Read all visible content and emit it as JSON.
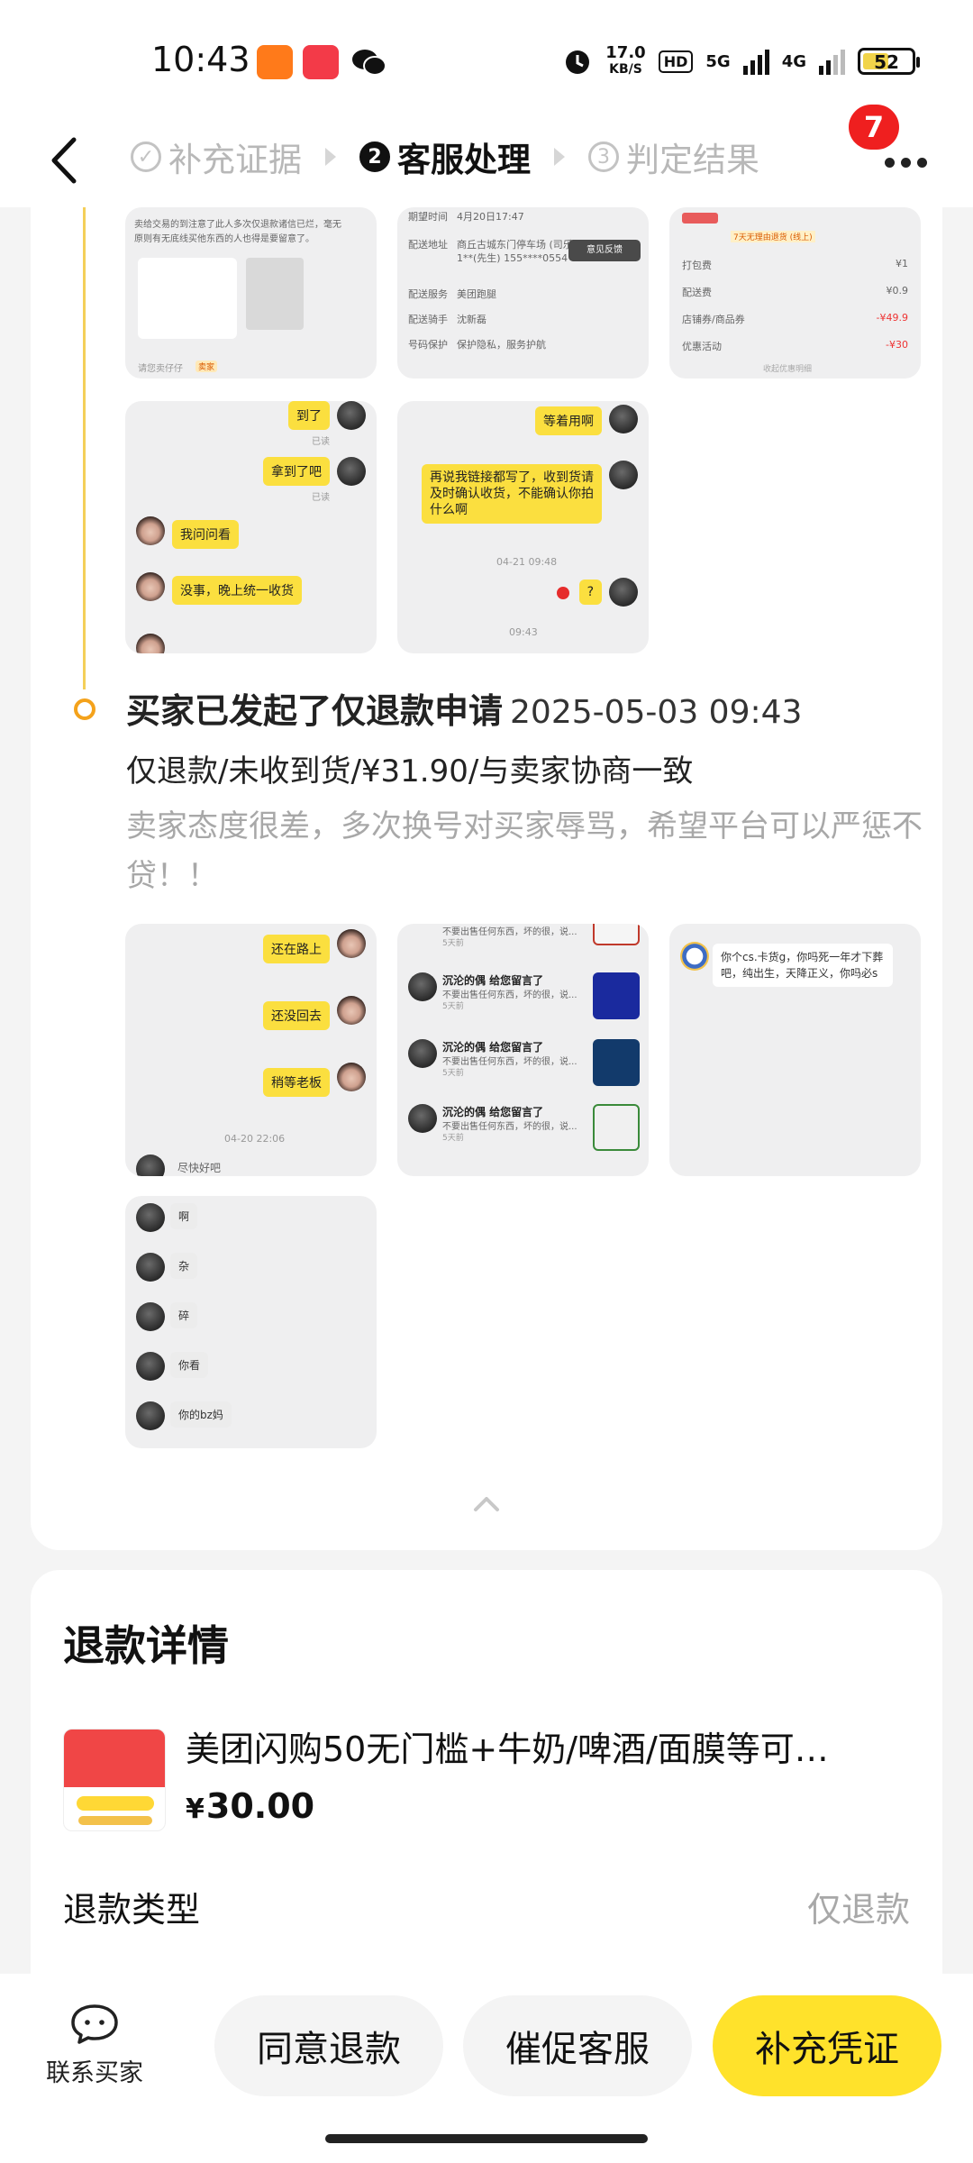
{
  "status_bar": {
    "time": "10:43",
    "net_speed_value": "17.0",
    "net_speed_unit": "KB/S",
    "hd_badge": "HD",
    "net_5g": "5G",
    "net_4g": "4G",
    "battery": "52"
  },
  "header": {
    "steps": [
      {
        "num": "✓",
        "label": "补充证据"
      },
      {
        "num": "2",
        "label": "客服处理"
      },
      {
        "num": "3",
        "label": "判定结果"
      }
    ],
    "notification_count": "7"
  },
  "evidence_top": {
    "thumb1_lines": [
      "卖给交易的到注意了此人多次仅退款诸信已烂，毫无",
      "原则有无底线买他东西的人也得是要留意了。"
    ],
    "thumb1_footer": "请您卖仔仔",
    "thumb1_footer_tag": "卖家",
    "thumb2_rows": [
      {
        "k": "期望时间",
        "v": "4月20日17:47"
      },
      {
        "k": "配送地址",
        "v": "商丘古城东门停车场 (司乐"
      },
      {
        "k": "",
        "v": "1**(先生) 155****0554"
      },
      {
        "k": "配送服务",
        "v": "美团跑腿"
      },
      {
        "k": "配送骑手",
        "v": "沈新磊"
      },
      {
        "k": "号码保护",
        "v": "保护隐私，服务护航"
      }
    ],
    "thumb2_feedback": "意见反馈",
    "thumb3_rows": [
      {
        "k": "打包费",
        "v": "¥1"
      },
      {
        "k": "配送费",
        "v": "¥0.9"
      },
      {
        "k": "店铺券/商品券",
        "v": "-¥49.9"
      },
      {
        "k": "优惠活动",
        "v": "-¥30"
      }
    ],
    "thumb3_tag": "7天无理由退货 (线上)",
    "thumb3_footer": "收起优惠明细"
  },
  "chat_a": {
    "messages": [
      "到了",
      "拿到了吧",
      "我问问看",
      "没事，晚上统一收货"
    ],
    "read": "已读"
  },
  "chat_b": {
    "messages": [
      "等着用啊",
      "再说我链接都写了，收到货请及时确认收货，不能确认你拍什么啊",
      "?"
    ],
    "times": [
      "04-21 09:48",
      "09:43"
    ]
  },
  "event": {
    "title": "买家已发起了仅退款申请",
    "time": "2025-05-03 09:43",
    "subtitle": "仅退款/未收到货/¥31.90/与卖家协商一致",
    "description": "卖家态度很差，多次换号对买家辱骂，希望平台可以严惩不贷！！"
  },
  "evidence_bottom": {
    "chat_c": {
      "messages": [
        "还在路上",
        "还没回去",
        "稍等老板",
        "尽快好吧"
      ],
      "time": "04-20 22:06"
    },
    "chat_d": {
      "sender": "沉沦的偶 给您留言了",
      "preview": "不要出售任何东西，坏的很，说...",
      "items": [
        "5天前",
        "5天前",
        "5天前",
        "5天前"
      ]
    },
    "chat_e": {
      "message": "你个cs.卡货g，你吗死一年才下葬吧，纯出生，天降正义，你吗必s"
    },
    "chat_f": {
      "messages": [
        "啊",
        "杂",
        "碎",
        "你看",
        "你的bz妈"
      ]
    }
  },
  "refund": {
    "title": "退款详情",
    "product_name": "美团闪购50无门槛+牛奶/啤酒/面膜等可…",
    "price_currency": "¥",
    "price": "30.00",
    "type_label": "退款类型",
    "type_value": "仅退款"
  },
  "bottom_bar": {
    "contact_label": "联系买家",
    "btn_agree": "同意退款",
    "btn_urge": "催促客服",
    "btn_supplement": "补充凭证"
  },
  "colors": {
    "accent_yellow": "#ffe22b",
    "timeline_line": "#f4cf59",
    "timeline_dot": "#f4a21b",
    "badge_red": "#ef1f1f"
  }
}
